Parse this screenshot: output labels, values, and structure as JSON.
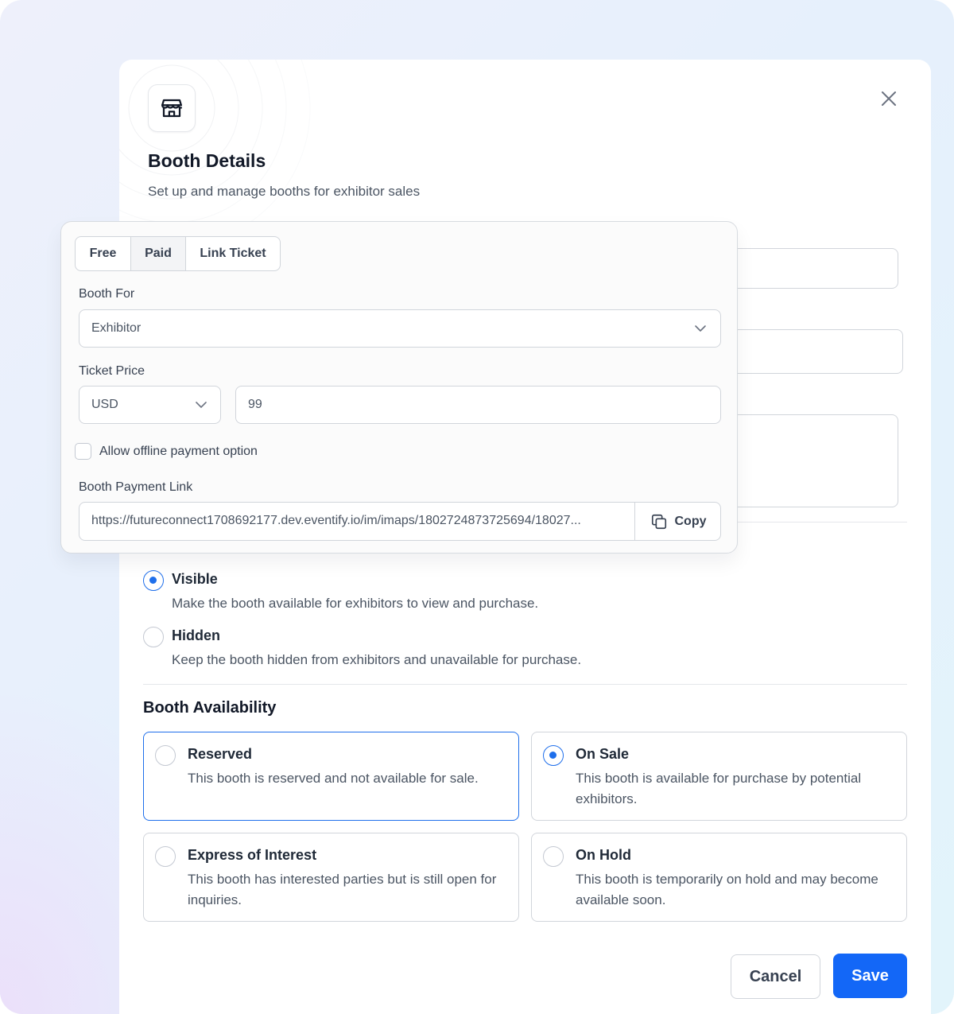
{
  "header": {
    "icon": "storefront-icon",
    "title": "Booth Details",
    "subtitle": "Set up and manage booths for exhibitor sales"
  },
  "ticket_type": {
    "options": [
      "Free",
      "Paid",
      "Link Ticket"
    ],
    "selected": "Paid"
  },
  "booth_for": {
    "label": "Booth For",
    "value": "Exhibitor"
  },
  "ticket_price": {
    "label": "Ticket Price",
    "currency": "USD",
    "amount": "99"
  },
  "offline_payment": {
    "label": "Allow offline payment option",
    "checked": false
  },
  "payment_link": {
    "label": "Booth Payment Link",
    "value": "https://futureconnect1708692177.dev.eventify.io/im/imaps/1802724873725694/18027...",
    "copy_label": "Copy"
  },
  "visibility": {
    "options": [
      {
        "title": "Visible",
        "description": "Make the booth available for exhibitors to view and purchase.",
        "checked": true
      },
      {
        "title": "Hidden",
        "description": "Keep the booth hidden from exhibitors and unavailable for purchase.",
        "checked": false
      }
    ]
  },
  "availability": {
    "title": "Booth Availability",
    "options": [
      {
        "title": "Reserved",
        "description": "This booth is reserved and not available for sale.",
        "checked": false
      },
      {
        "title": "On Sale",
        "description": "This booth is available for purchase by potential exhibitors.",
        "checked": true
      },
      {
        "title": "Express of Interest",
        "description": "This booth has interested parties but is still open for inquiries.",
        "checked": false
      },
      {
        "title": "On Hold",
        "description": "This booth is temporarily on hold and may become available soon.",
        "checked": false
      }
    ]
  },
  "footer": {
    "cancel_label": "Cancel",
    "save_label": "Save"
  },
  "colors": {
    "accent": "#1367f7",
    "radio_selected": "#1f6feb"
  }
}
